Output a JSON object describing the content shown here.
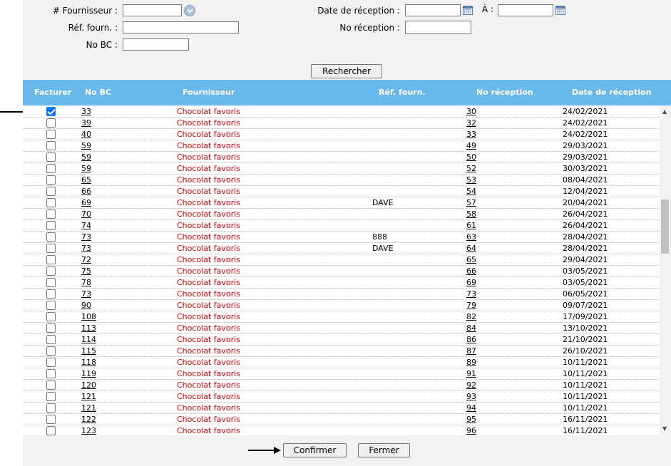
{
  "search": {
    "fournisseur_label": "# Fournisseur :",
    "fournisseur_value": "",
    "ref_label": "Réf. fourn. :",
    "ref_value": "",
    "nobc_label": "No BC :",
    "nobc_value": "",
    "date_label": "Date de réception :",
    "date_from": "",
    "a_label": "À :",
    "date_to": "",
    "noreception_label": "No réception :",
    "noreception_value": "",
    "search_button": "Rechercher"
  },
  "table": {
    "headers": [
      "Facturer",
      "No BC",
      "Fournisseur",
      "Réf. fourn.",
      "No réception",
      "Date de réception"
    ],
    "rows": [
      {
        "checked": true,
        "bc": "33",
        "fournisseur": "Chocolat favoris",
        "ref": "",
        "reception": "30",
        "date": "24/02/2021"
      },
      {
        "checked": false,
        "bc": "39",
        "fournisseur": "Chocolat favoris",
        "ref": "",
        "reception": "32",
        "date": "24/02/2021"
      },
      {
        "checked": false,
        "bc": "40",
        "fournisseur": "Chocolat favoris",
        "ref": "",
        "reception": "33",
        "date": "24/02/2021"
      },
      {
        "checked": false,
        "bc": "59",
        "fournisseur": "Chocolat favoris",
        "ref": "",
        "reception": "49",
        "date": "29/03/2021"
      },
      {
        "checked": false,
        "bc": "59",
        "fournisseur": "Chocolat favoris",
        "ref": "",
        "reception": "50",
        "date": "29/03/2021"
      },
      {
        "checked": false,
        "bc": "59",
        "fournisseur": "Chocolat favoris",
        "ref": "",
        "reception": "52",
        "date": "30/03/2021"
      },
      {
        "checked": false,
        "bc": "65",
        "fournisseur": "Chocolat favoris",
        "ref": "",
        "reception": "53",
        "date": "08/04/2021"
      },
      {
        "checked": false,
        "bc": "66",
        "fournisseur": "Chocolat favoris",
        "ref": "",
        "reception": "54",
        "date": "12/04/2021"
      },
      {
        "checked": false,
        "bc": "69",
        "fournisseur": "Chocolat favoris",
        "ref": "DAVE",
        "reception": "57",
        "date": "20/04/2021"
      },
      {
        "checked": false,
        "bc": "70",
        "fournisseur": "Chocolat favoris",
        "ref": "",
        "reception": "58",
        "date": "26/04/2021"
      },
      {
        "checked": false,
        "bc": "74",
        "fournisseur": "Chocolat favoris",
        "ref": "",
        "reception": "61",
        "date": "26/04/2021"
      },
      {
        "checked": false,
        "bc": "73",
        "fournisseur": "Chocolat favoris",
        "ref": "888",
        "reception": "63",
        "date": "28/04/2021"
      },
      {
        "checked": false,
        "bc": "73",
        "fournisseur": "Chocolat favoris",
        "ref": "DAVE",
        "reception": "64",
        "date": "28/04/2021"
      },
      {
        "checked": false,
        "bc": "72",
        "fournisseur": "Chocolat favoris",
        "ref": "",
        "reception": "65",
        "date": "29/04/2021"
      },
      {
        "checked": false,
        "bc": "75",
        "fournisseur": "Chocolat favoris",
        "ref": "",
        "reception": "66",
        "date": "03/05/2021"
      },
      {
        "checked": false,
        "bc": "78",
        "fournisseur": "Chocolat favoris",
        "ref": "",
        "reception": "69",
        "date": "03/05/2021"
      },
      {
        "checked": false,
        "bc": "73",
        "fournisseur": "Chocolat favoris",
        "ref": "",
        "reception": "73",
        "date": "06/05/2021"
      },
      {
        "checked": false,
        "bc": "90",
        "fournisseur": "Chocolat favoris",
        "ref": "",
        "reception": "79",
        "date": "09/07/2021"
      },
      {
        "checked": false,
        "bc": "108",
        "fournisseur": "Chocolat favoris",
        "ref": "",
        "reception": "82",
        "date": "17/09/2021"
      },
      {
        "checked": false,
        "bc": "113",
        "fournisseur": "Chocolat favoris",
        "ref": "",
        "reception": "84",
        "date": "13/10/2021"
      },
      {
        "checked": false,
        "bc": "114",
        "fournisseur": "Chocolat favoris",
        "ref": "",
        "reception": "86",
        "date": "21/10/2021"
      },
      {
        "checked": false,
        "bc": "115",
        "fournisseur": "Chocolat favoris",
        "ref": "",
        "reception": "87",
        "date": "26/10/2021"
      },
      {
        "checked": false,
        "bc": "118",
        "fournisseur": "Chocolat favoris",
        "ref": "",
        "reception": "89",
        "date": "10/11/2021"
      },
      {
        "checked": false,
        "bc": "119",
        "fournisseur": "Chocolat favoris",
        "ref": "",
        "reception": "91",
        "date": "10/11/2021"
      },
      {
        "checked": false,
        "bc": "120",
        "fournisseur": "Chocolat favoris",
        "ref": "",
        "reception": "92",
        "date": "10/11/2021"
      },
      {
        "checked": false,
        "bc": "121",
        "fournisseur": "Chocolat favoris",
        "ref": "",
        "reception": "93",
        "date": "10/11/2021"
      },
      {
        "checked": false,
        "bc": "121",
        "fournisseur": "Chocolat favoris",
        "ref": "",
        "reception": "94",
        "date": "10/11/2021"
      },
      {
        "checked": false,
        "bc": "122",
        "fournisseur": "Chocolat favoris",
        "ref": "",
        "reception": "95",
        "date": "16/11/2021"
      },
      {
        "checked": false,
        "bc": "123",
        "fournisseur": "Chocolat favoris",
        "ref": "",
        "reception": "96",
        "date": "16/11/2021"
      }
    ]
  },
  "footer": {
    "confirm_button": "Confirmer",
    "close_button": "Fermer"
  },
  "colors": {
    "header_bg": "#68b8ec",
    "supplier_text": "#e00000",
    "panel_bg": "#f2f2f2"
  },
  "icons": [
    "dropdown-icon",
    "calendar-icon",
    "arrow-indicator-icon",
    "scroll-up-icon",
    "scroll-down-icon"
  ]
}
